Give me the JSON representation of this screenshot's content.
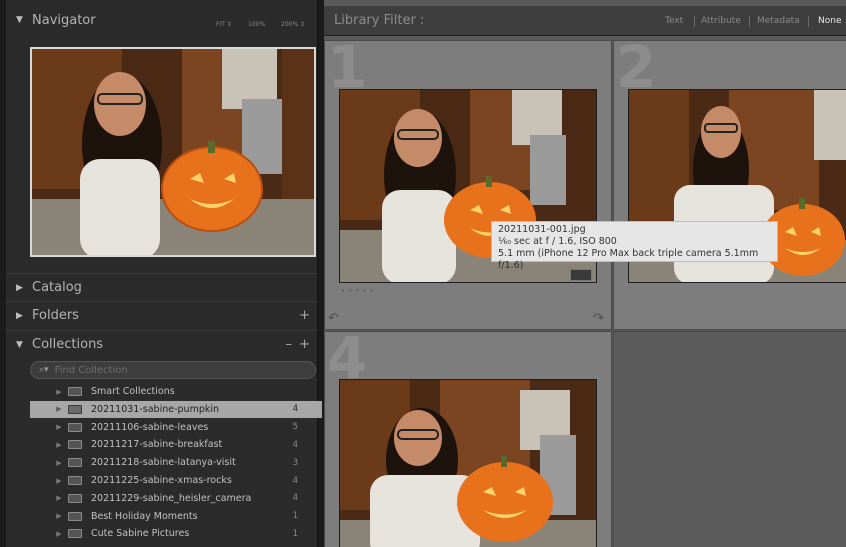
{
  "navigator": {
    "title": "Navigator",
    "zoom_options": [
      "FIT ↕",
      "100%",
      "200% ↕"
    ]
  },
  "panels": {
    "catalog": "Catalog",
    "folders": "Folders",
    "collections": "Collections",
    "plus": "+",
    "minus": "–"
  },
  "collections": {
    "search_placeholder": "Find Collection",
    "items": [
      {
        "label": "Smart Collections",
        "count": "",
        "type": "set"
      },
      {
        "label": "20211031-sabine-pumpkin",
        "count": "4",
        "selected": true
      },
      {
        "label": "20211106-sabine-leaves",
        "count": "5"
      },
      {
        "label": "20211217-sabine-breakfast",
        "count": "4"
      },
      {
        "label": "20211218-sabine-latanya-visit",
        "count": "3"
      },
      {
        "label": "20211225-sabine-xmas-rocks",
        "count": "4"
      },
      {
        "label": "20211229-sabine_heisler_camera",
        "count": "4"
      },
      {
        "label": "Best Holiday Moments",
        "count": "1"
      },
      {
        "label": "Cute Sabine Pictures",
        "count": "1"
      }
    ]
  },
  "library_filter": {
    "title": "Library Filter :",
    "tabs": [
      "Text",
      "Attribute",
      "Metadata",
      "None"
    ],
    "active": "None"
  },
  "grid": {
    "cell_numbers": [
      "1",
      "2",
      "4"
    ]
  },
  "tooltip": {
    "filename": "20211031-001.jpg",
    "exposure": "⅙₀ sec at f / 1.6, ISO 800",
    "lens": "5.1 mm (iPhone 12 Pro Max back triple camera 5.1mm f/1.6)"
  },
  "colors": {
    "panel_bg": "#2b2b2b",
    "grid_bg": "#5a5a5a",
    "cell_bg": "#7d7d7d",
    "selected_row": "#a7a7a7",
    "pumpkin": "#e8721c",
    "tooltip_bg": "#e6e6e6"
  }
}
